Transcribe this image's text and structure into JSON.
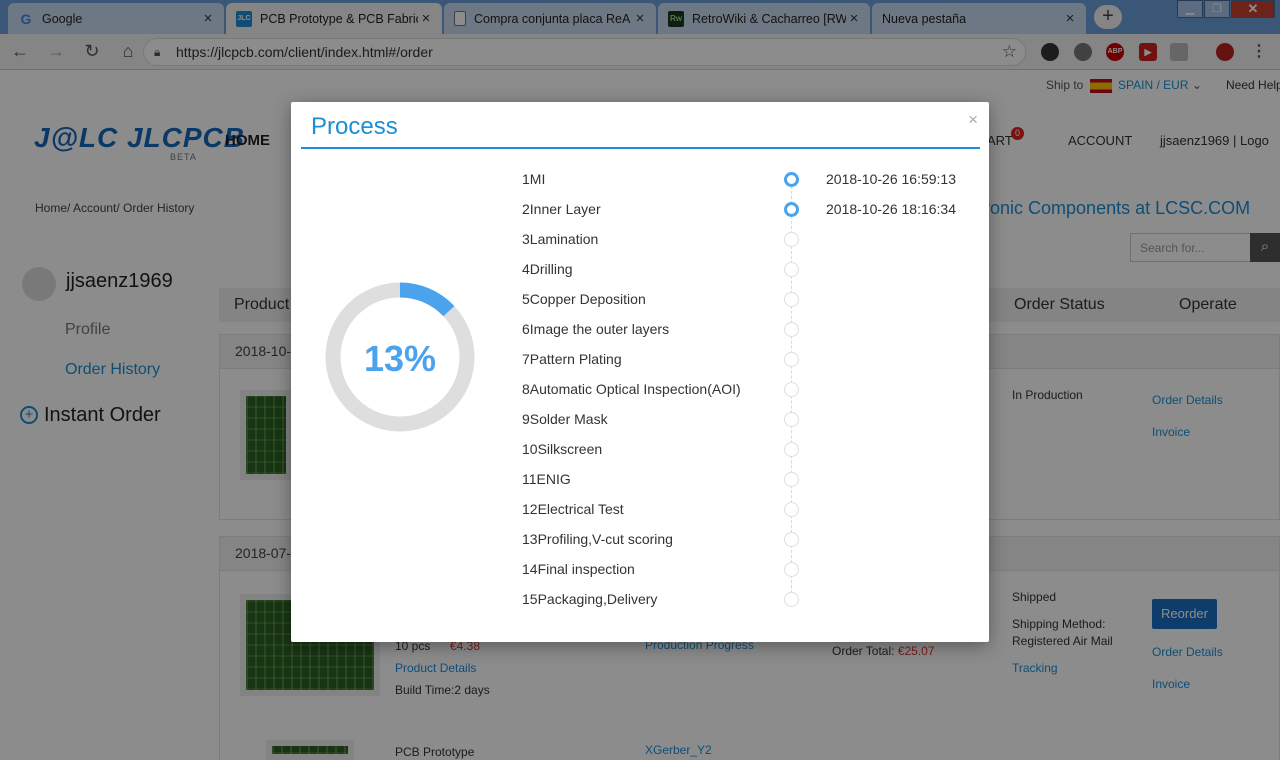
{
  "browser": {
    "tabs": [
      {
        "title": "Google",
        "icon": "G"
      },
      {
        "title": "PCB Prototype & PCB Fabrica",
        "icon": "JLC"
      },
      {
        "title": "Compra conjunta placa ReA",
        "icon": "doc"
      },
      {
        "title": "RetroWiki & Cacharreo [RW]",
        "icon": "Rw"
      },
      {
        "title": "Nueva pestaña",
        "icon": ""
      }
    ],
    "url": "https://jlcpcb.com/client/index.html#/order",
    "ext_abp": "ABP"
  },
  "site": {
    "ship_to_label": "Ship to",
    "country_currency": "SPAIN /  EUR",
    "need_help": "Need Help",
    "logo": "J@LC JLCPCB",
    "logo_beta": "BETA",
    "nav_home": "HOME",
    "nav_cart": "ART",
    "cart_count": "0",
    "nav_account": "ACCOUNT",
    "user_top": "jjsaenz1969   |   Logo",
    "breadcrumb": "Home/  Account/  Order History",
    "lcsc_banner": "ectronic Components at LCSC.COM",
    "search_placeholder": "Search for..."
  },
  "sidebar": {
    "username": "jjsaenz1969",
    "profile": "Profile",
    "order_history": "Order History",
    "instant_order": "Instant Order"
  },
  "table": {
    "headers": {
      "product": "Product",
      "status": "Order Status",
      "operate": "Operate"
    }
  },
  "orders": [
    {
      "date": "2018-10-",
      "status": "In Production",
      "order_details": "Order Details",
      "invoice": "Invoice"
    },
    {
      "date": "2018-07-",
      "qty": "10 pcs",
      "price": "€4.38",
      "product_details": "Product Details",
      "build_time": "Build Time:2 days",
      "production_progress": "Production Progress",
      "order_total_label": "Order Total:",
      "order_total": "€25.07",
      "status": "Shipped",
      "shipping_method": "Shipping Method:",
      "shipping_value": "Registered Air Mail",
      "tracking": "Tracking",
      "reorder": "Reorder",
      "order_details": "Order Details",
      "invoice": "Invoice"
    },
    {
      "product": "PCB Prototype",
      "gerber": "XGerber_Y2"
    }
  ],
  "modal": {
    "title": "Process",
    "close": "×",
    "progress_percent": 13,
    "progress_label": "13%",
    "steps": [
      {
        "label": "1MI",
        "time": "2018-10-26 16:59:13",
        "done": true
      },
      {
        "label": "2Inner Layer",
        "time": "2018-10-26 18:16:34",
        "done": true
      },
      {
        "label": "3Lamination",
        "time": "",
        "done": false
      },
      {
        "label": "4Drilling",
        "time": "",
        "done": false
      },
      {
        "label": "5Copper Deposition",
        "time": "",
        "done": false
      },
      {
        "label": "6Image the outer layers",
        "time": "",
        "done": false
      },
      {
        "label": "7Pattern Plating",
        "time": "",
        "done": false
      },
      {
        "label": "8Automatic Optical Inspection(AOI)",
        "time": "",
        "done": false
      },
      {
        "label": "9Solder Mask",
        "time": "",
        "done": false
      },
      {
        "label": "10Silkscreen",
        "time": "",
        "done": false
      },
      {
        "label": "11ENIG",
        "time": "",
        "done": false
      },
      {
        "label": "12Electrical Test",
        "time": "",
        "done": false
      },
      {
        "label": "13Profiling,V-cut scoring",
        "time": "",
        "done": false
      },
      {
        "label": "14Final inspection",
        "time": "",
        "done": false
      },
      {
        "label": "15Packaging,Delivery",
        "time": "",
        "done": false
      }
    ]
  },
  "colors": {
    "accent": "#1a8fd6",
    "progress": "#4aa3ec",
    "track": "#dedede"
  }
}
